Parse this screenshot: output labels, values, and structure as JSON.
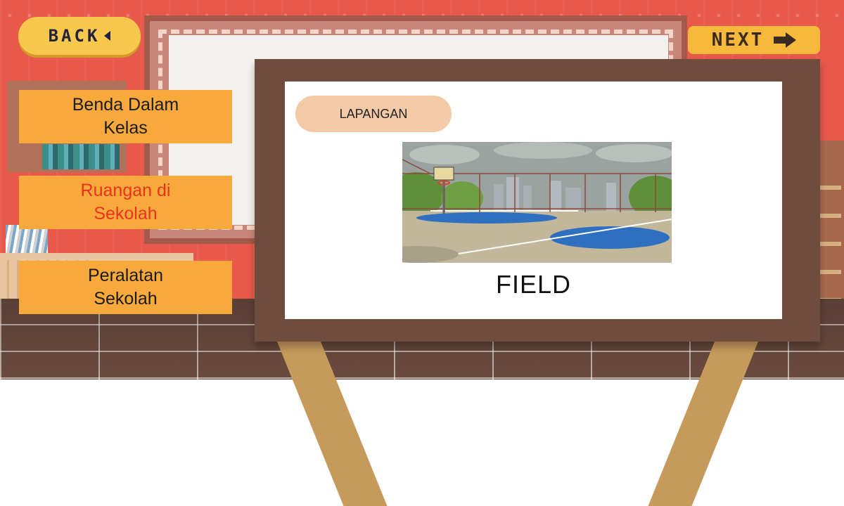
{
  "nav": {
    "back_label": "BACK",
    "next_label": "NEXT"
  },
  "menu": {
    "items": [
      {
        "label": "Benda Dalam\nKelas",
        "active": false
      },
      {
        "label": "Ruangan di\nSekolah",
        "active": true
      },
      {
        "label": "Peralatan\nSekolah",
        "active": false
      }
    ]
  },
  "card": {
    "indonesian_word": "LAPANGAN",
    "english_word": "FIELD",
    "picture_icon": "basketball-court-illustration"
  },
  "colors": {
    "wall": "#e8584b",
    "menu_bg": "#f7a93b",
    "menu_active_text": "#e8331f",
    "easel_frame": "#6e4d3f",
    "pill_bg": "#f3c9a6"
  }
}
